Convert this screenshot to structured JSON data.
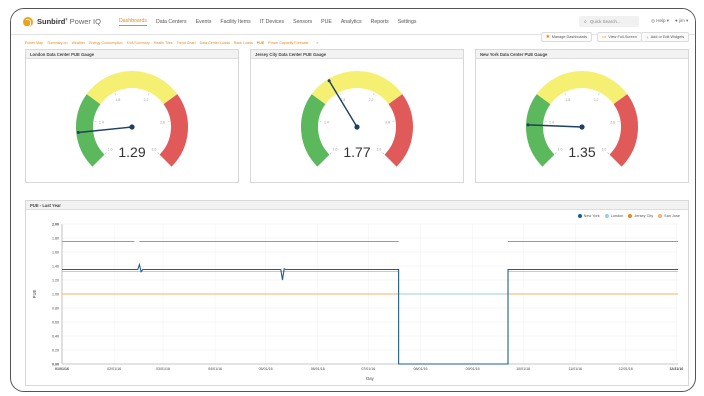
{
  "nav": {
    "brand": "Sunbird",
    "product": "Power IQ",
    "links": [
      {
        "label": "Dashboards",
        "active": true
      },
      {
        "label": "Data Centers",
        "active": false
      },
      {
        "label": "Events",
        "active": false
      },
      {
        "label": "Facility Items",
        "active": false
      },
      {
        "label": "IT Devices",
        "active": false
      },
      {
        "label": "Sensors",
        "active": false
      },
      {
        "label": "PUE",
        "active": false
      },
      {
        "label": "Analytics",
        "active": false
      },
      {
        "label": "Reports",
        "active": false
      },
      {
        "label": "Settings",
        "active": false
      }
    ],
    "search_placeholder": "Quick Search...",
    "help_label": "Help",
    "user_label": "jim"
  },
  "subnav": {
    "links": [
      {
        "label": "Power Map",
        "active": false
      },
      {
        "label": "Summary on",
        "active": false
      },
      {
        "label": "Weather",
        "active": false
      },
      {
        "label": "Energy Consumption",
        "active": false
      },
      {
        "label": "KVA Summary",
        "active": false
      },
      {
        "label": "Health Tiles",
        "active": false
      },
      {
        "label": "Trend Chart",
        "active": false
      },
      {
        "label": "Data Center Loads",
        "active": false
      },
      {
        "label": "Rack Loads",
        "active": false
      },
      {
        "label": "PUE",
        "active": true
      },
      {
        "label": "Power Capacity Forecast",
        "active": false
      }
    ],
    "more": "»",
    "buttons": {
      "manage": "Manage Dashboards",
      "fullscreen": "View Full-Screen",
      "add_widgets": "Add or Edit Widgets"
    }
  },
  "gauges": [
    {
      "title": "London Data Center PUE Gauge",
      "value": 1.29,
      "display": "1.29"
    },
    {
      "title": "Jersey City Data Center PUE Gauge",
      "value": 1.77,
      "display": "1.77"
    },
    {
      "title": "New York Data Center PUE Gauge",
      "value": 1.35,
      "display": "1.35"
    }
  ],
  "gauge_scale": {
    "min": 1.0,
    "max": 3.0,
    "bands": [
      {
        "from": 1.0,
        "to": 1.6,
        "color": "#5cb85c"
      },
      {
        "from": 1.6,
        "to": 2.4,
        "color": "#f5ef72"
      },
      {
        "from": 2.4,
        "to": 3.0,
        "color": "#e05a5a"
      }
    ],
    "ticks": [
      "1.0",
      "1.4",
      "1.8",
      "2.2",
      "2.6",
      "3.0"
    ]
  },
  "pue_panel": {
    "title": "PUE - Last Year"
  },
  "chart_data": {
    "type": "line",
    "title": "",
    "xlabel": "Day",
    "ylabel": "PUE",
    "ylim": [
      0,
      2.0
    ],
    "y_ticks": [
      "0.00",
      "0.20",
      "0.40",
      "0.60",
      "0.80",
      "1.00",
      "1.20",
      "1.40",
      "1.60",
      "1.80",
      "2.00"
    ],
    "x_ticks": [
      "01/01/16",
      "02/01/16",
      "03/01/16",
      "04/01/16",
      "05/01/16",
      "06/01/16",
      "07/01/16",
      "08/01/16",
      "09/01/16",
      "10/01/16",
      "11/01/16",
      "12/01/16",
      "12/31/16"
    ],
    "legend_position": "top-right",
    "grid": true,
    "series": [
      {
        "name": "New York",
        "color": "#1f5f8b",
        "points": [
          [
            0,
            1.35
          ],
          [
            45,
            1.35
          ],
          [
            46,
            1.42
          ],
          [
            47,
            1.32
          ],
          [
            48,
            1.35
          ],
          [
            130,
            1.35
          ],
          [
            131,
            1.2
          ],
          [
            132,
            1.36
          ],
          [
            133,
            1.35
          ],
          [
            200,
            1.35
          ],
          [
            200,
            0
          ],
          [
            265,
            0
          ],
          [
            265,
            1.35
          ],
          [
            366,
            1.35
          ]
        ]
      },
      {
        "name": "London",
        "color": "#9ecbe6",
        "points": [
          [
            0,
            1.32
          ],
          [
            200,
            1.32
          ],
          [
            200,
            1.0
          ],
          [
            265,
            1.0
          ],
          [
            265,
            1.32
          ],
          [
            366,
            1.32
          ]
        ]
      },
      {
        "name": "Jersey City",
        "color": "#e8891d",
        "points": [
          [
            0,
            1.75
          ],
          [
            43,
            1.75
          ],
          [
            null,
            null
          ],
          [
            46,
            1.75
          ],
          [
            200,
            1.75
          ],
          [
            null,
            null
          ],
          [
            265,
            1.75
          ],
          [
            366,
            1.75
          ]
        ]
      },
      {
        "name": "San Jose",
        "color": "#f5b26b",
        "points": [
          [
            0,
            1.0
          ],
          [
            366,
            1.0
          ]
        ]
      }
    ]
  },
  "colors": {
    "accent": "#e8891d",
    "green": "#5cb85c",
    "yellow": "#f5ef72",
    "red": "#e05a5a",
    "needle": "#1f3f63"
  }
}
